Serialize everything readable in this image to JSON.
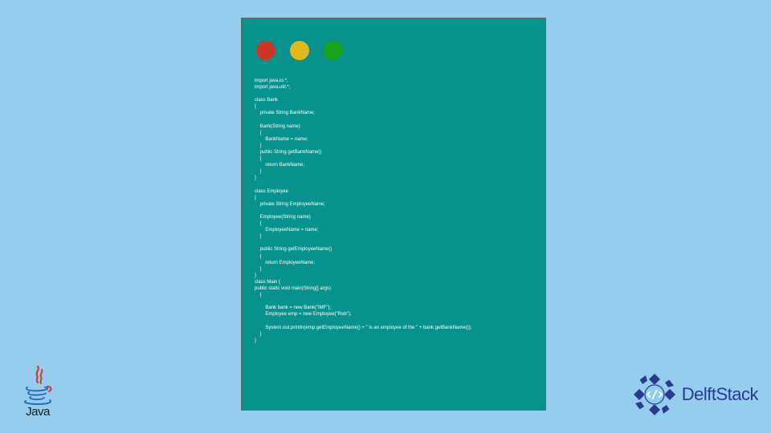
{
  "window": {
    "dots": [
      "red",
      "yellow",
      "green"
    ]
  },
  "code": {
    "lines": [
      "import java.io.*;",
      "import java.util.*;",
      "",
      "class Bank",
      "{",
      "    private String BankName;",
      "",
      "    Bank(String name)",
      "    {",
      "        BankName = name;",
      "    }",
      "    public String getBankName()",
      "    {",
      "        return BankName;",
      "    }",
      "}",
      "",
      "class Employee",
      "{",
      "    private String EmployeeName;",
      "",
      "    Employee(String name)",
      "    {",
      "        EmployeeName = name;",
      "    }",
      "",
      "    public String getEmployeeName()",
      "    {",
      "        return EmployeeName;",
      "    }",
      "}",
      "class Main {",
      "public static void main(String[] args)",
      "    {",
      "",
      "        Bank bank = new Bank(\"IMF\");",
      "        Employee emp = new Employee(\"Rob\");",
      "",
      "        System.out.println(emp.getEmployeeName() + \" is an employee of the \" + bank.getBankName());",
      "    }",
      "}"
    ]
  },
  "logos": {
    "java_label": "Java",
    "delft_label": "DelftStack"
  },
  "colors": {
    "background": "#94cded",
    "window_bg": "#08928d",
    "code_text": "#ffffff",
    "java_cup": "#d13b2e",
    "java_steam": "#2f6eb5",
    "delft_blue": "#2b3a8f"
  }
}
